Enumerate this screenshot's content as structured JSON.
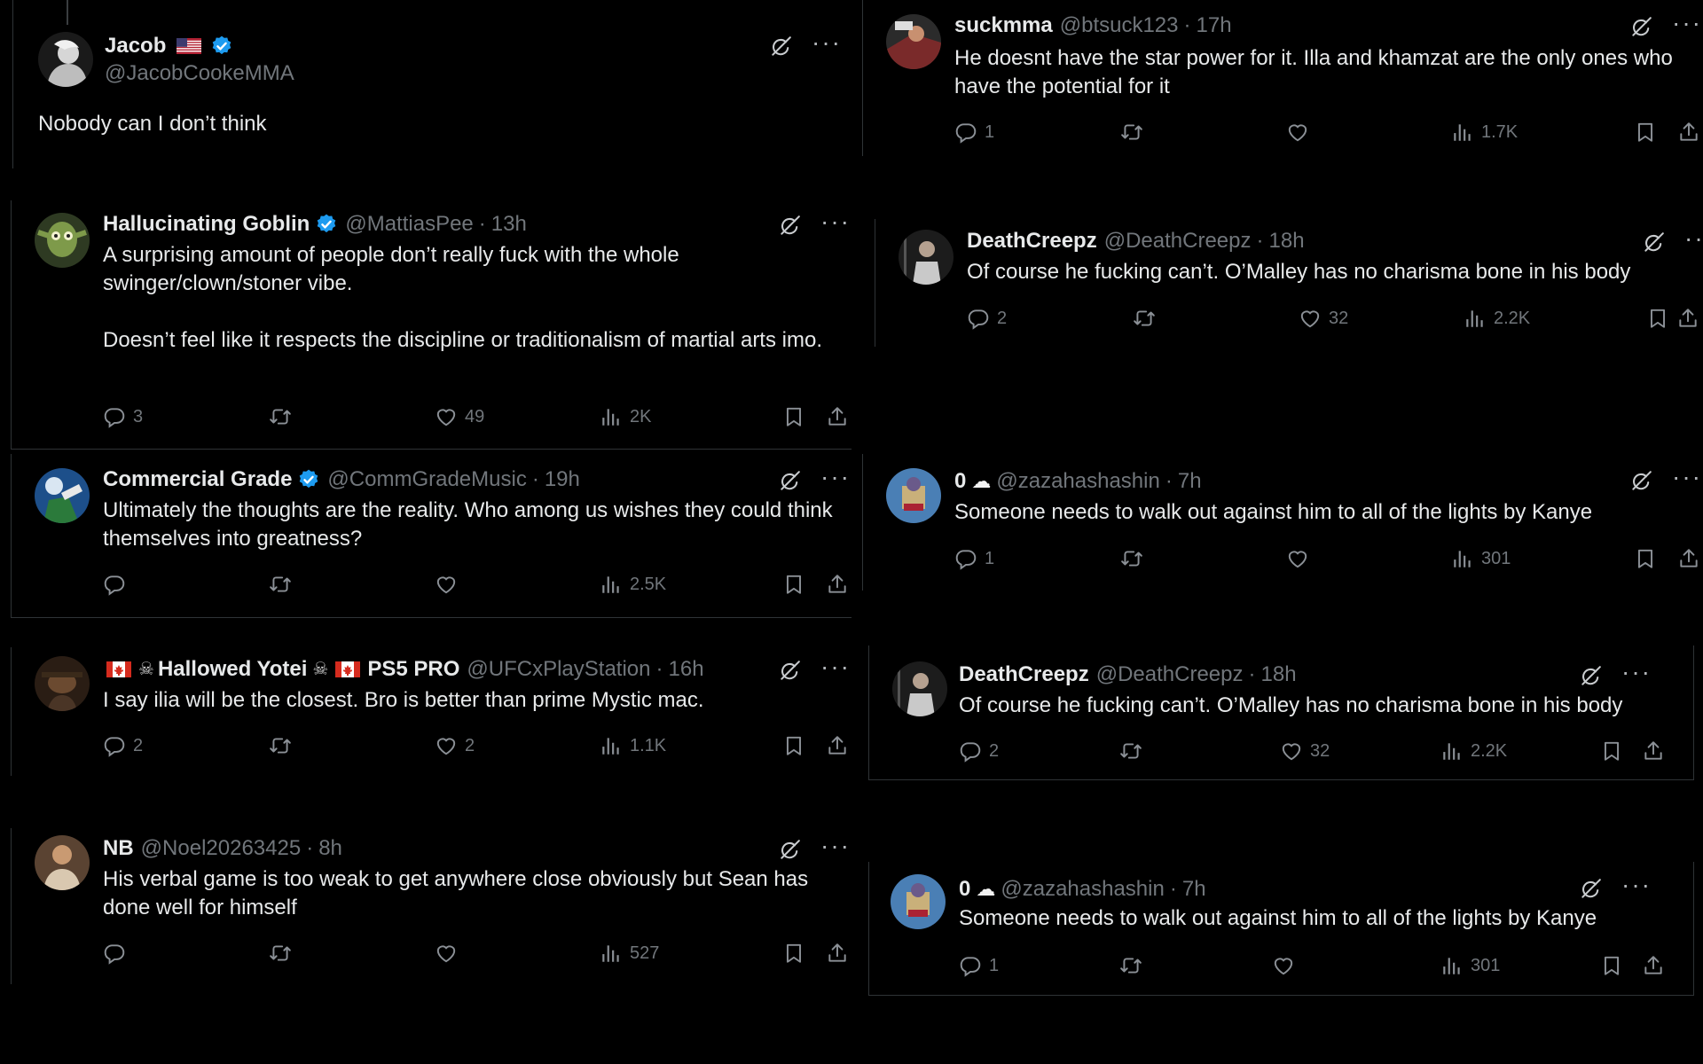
{
  "colors": {
    "background": "#000000",
    "text": "#e7e9ea",
    "muted": "#71767b",
    "verified": "#1d9bf0",
    "divider": "#2f3336"
  },
  "icons": {
    "grok": "grok-icon",
    "more": "more-icon",
    "reply": "reply-icon",
    "retweet": "retweet-icon",
    "like": "heart-icon",
    "views": "views-icon",
    "bookmark": "bookmark-icon",
    "share": "share-icon",
    "verified": "verified-badge-icon",
    "flag_us": "us-flag-icon",
    "flag_ca": "canada-flag-icon",
    "pirate": "skull-crossbones-icon",
    "cloud": "cloud-icon"
  },
  "main_post": {
    "name": "Jacob",
    "handle": "@JacobCookeMMA",
    "text": "Nobody can I don’t think",
    "more": "···"
  },
  "left": [
    {
      "name": "Hallucinating Goblin",
      "handle": "@MattiasPee",
      "time": "13h",
      "text": "A surprising amount of people don’t really fuck with the whole swinger/clown/stoner vibe.\n\nDoesn’t feel like it respects the discipline or traditionalism of martial arts imo.",
      "replies": "3",
      "retweets": "",
      "likes": "49",
      "views": "2K",
      "more": "···"
    },
    {
      "name": "Commercial Grade",
      "handle": "@CommGradeMusic",
      "time": "19h",
      "text": "Ultimately the thoughts are the reality. Who among us wishes they could think themselves into greatness?",
      "replies": "",
      "retweets": "",
      "likes": "",
      "views": "2.5K",
      "more": "···"
    },
    {
      "name_a": "Hallowed Yotei",
      "name_b": "PS5 PRO",
      "handle": "@UFCxPlayStation",
      "time": "16h",
      "text": "I say ilia will be the closest. Bro is better than prime Mystic mac.",
      "replies": "2",
      "retweets": "",
      "likes": "2",
      "views": "1.1K",
      "more": "···"
    },
    {
      "name": "NB",
      "handle": "@Noel20263425",
      "time": "8h",
      "text": "His verbal game is too weak to get anywhere close obviously but Sean has done well for himself",
      "replies": "",
      "retweets": "",
      "likes": "",
      "views": "527",
      "more": "···"
    }
  ],
  "right": [
    {
      "name": "suckmma",
      "handle": "@btsuck123",
      "time": "17h",
      "text": "He doesnt have the star power for it. Illa and khamzat are the only ones who have the potential for it",
      "replies": "1",
      "retweets": "",
      "likes": "",
      "views": "1.7K",
      "more": "···"
    },
    {
      "name": "DeathCreepz",
      "handle": "@DeathCreepz",
      "time": "18h",
      "text": "Of course he fucking can’t. O’Malley has no charisma bone in his body",
      "replies": "2",
      "retweets": "",
      "likes": "32",
      "views": "2.2K",
      "more": "···"
    },
    {
      "name": "0",
      "handle": "@zazahashashin",
      "time": "7h",
      "text": "Someone needs to walk out against him to all of the lights by Kanye",
      "replies": "1",
      "retweets": "",
      "likes": "",
      "views": "301",
      "more": "···"
    },
    {
      "name": "DeathCreepz",
      "handle": "@DeathCreepz",
      "time": "18h",
      "text": "Of course he fucking can’t. O’Malley has no charisma bone in his body",
      "replies": "2",
      "retweets": "",
      "likes": "32",
      "views": "2.2K",
      "more": "···"
    },
    {
      "name": "0",
      "handle": "@zazahashashin",
      "time": "7h",
      "text": "Someone needs to walk out against him to all of the lights by Kanye",
      "replies": "1",
      "retweets": "",
      "likes": "",
      "views": "301",
      "more": "···"
    }
  ],
  "separator": "·"
}
